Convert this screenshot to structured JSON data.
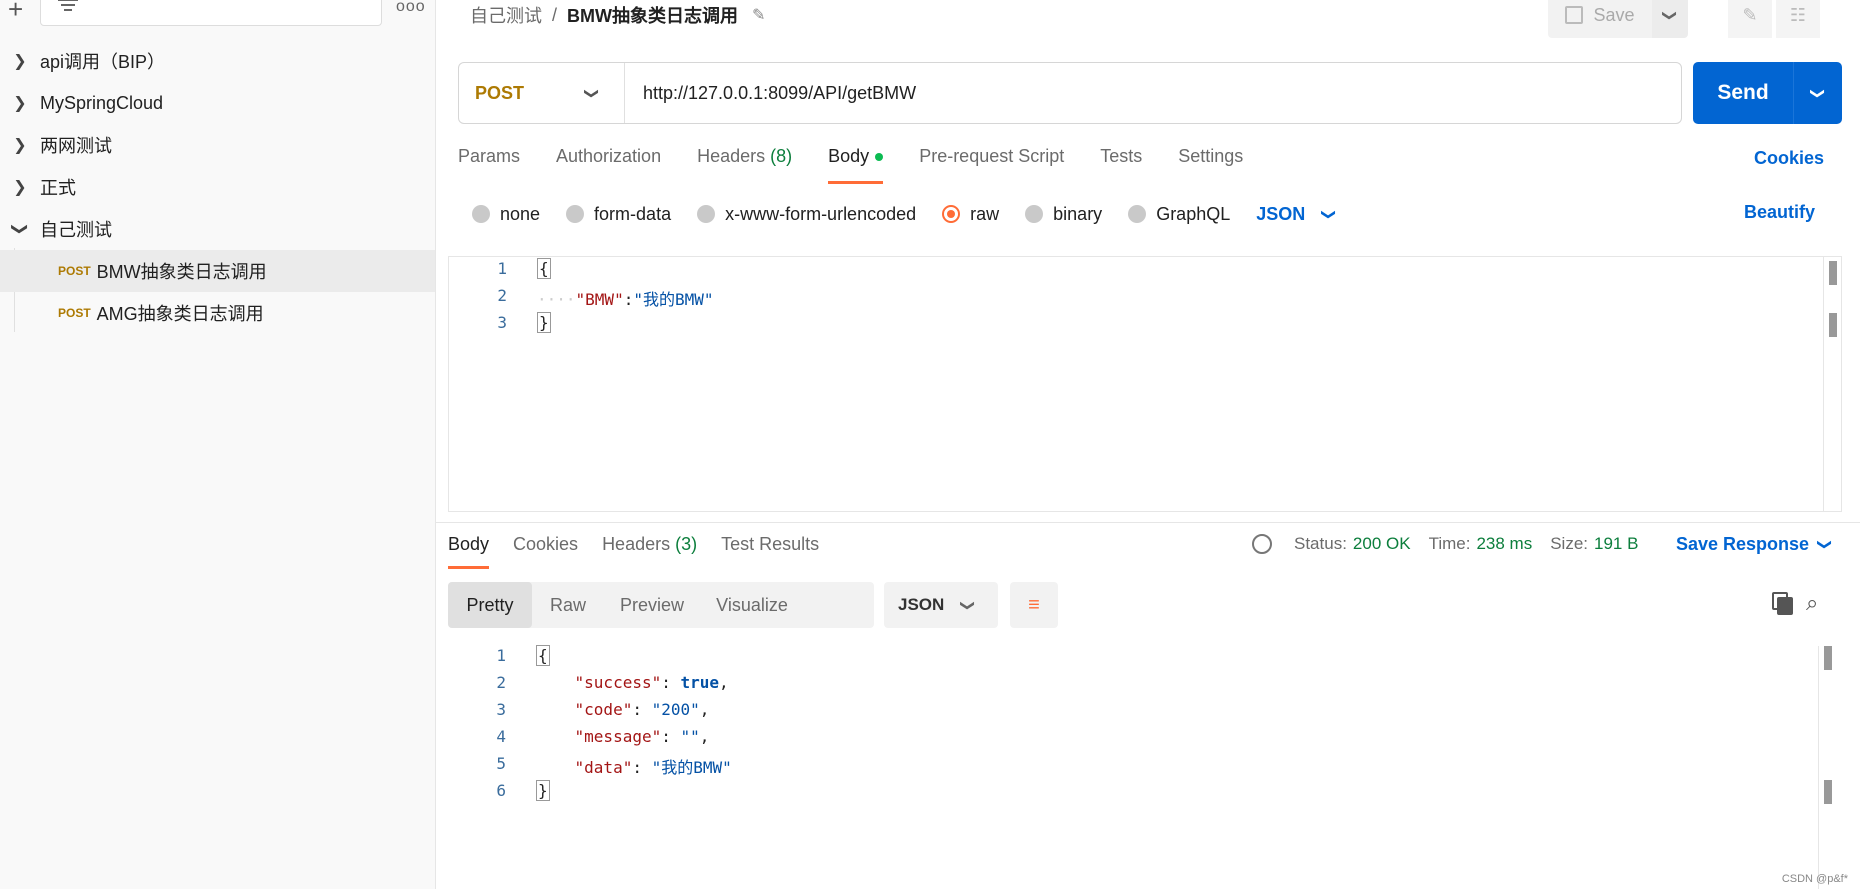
{
  "sidebar": {
    "collections": [
      {
        "label": "api调用（BIP）",
        "expanded": false
      },
      {
        "label": "MySpringCloud",
        "expanded": false
      },
      {
        "label": "两网测试",
        "expanded": false
      },
      {
        "label": "正式",
        "expanded": false
      },
      {
        "label": "自己测试",
        "expanded": true
      }
    ],
    "requests": [
      {
        "method": "POST",
        "name": "BMW抽象类日志调用",
        "selected": true
      },
      {
        "method": "POST",
        "name": "AMG抽象类日志调用",
        "selected": false
      }
    ]
  },
  "header": {
    "breadcrumb_parent": "自己测试",
    "breadcrumb_sep": "/",
    "title": "BMW抽象类日志调用",
    "save_label": "Save"
  },
  "request": {
    "method": "POST",
    "url": "http://127.0.0.1:8099/API/getBMW",
    "send_label": "Send"
  },
  "request_tabs": {
    "params": "Params",
    "authorization": "Authorization",
    "headers": "Headers",
    "headers_count": "(8)",
    "body": "Body",
    "prerequest": "Pre-request Script",
    "tests": "Tests",
    "settings": "Settings",
    "cookies": "Cookies"
  },
  "body_options": {
    "none": "none",
    "form_data": "form-data",
    "urlencoded": "x-www-form-urlencoded",
    "raw": "raw",
    "binary": "binary",
    "graphql": "GraphQL",
    "language": "JSON",
    "beautify": "Beautify"
  },
  "request_body": {
    "line_numbers": [
      "1",
      "2",
      "3"
    ],
    "open_brace": "{",
    "indent_dots": "····",
    "key": "\"BMW\"",
    "colon": ":",
    "value": "\"我的BMW\"",
    "close_brace": "}"
  },
  "response_tabs": {
    "body": "Body",
    "cookies": "Cookies",
    "headers": "Headers",
    "headers_count": "(3)",
    "test_results": "Test Results"
  },
  "response_status": {
    "status_label": "Status:",
    "status_value": "200 OK",
    "time_label": "Time:",
    "time_value": "238 ms",
    "size_label": "Size:",
    "size_value": "191 B",
    "save_response": "Save Response"
  },
  "response_views": {
    "pretty": "Pretty",
    "raw": "Raw",
    "preview": "Preview",
    "visualize": "Visualize",
    "format": "JSON"
  },
  "response_body": {
    "line_numbers": [
      "1",
      "2",
      "3",
      "4",
      "5",
      "6"
    ],
    "open_brace": "{",
    "k1": "\"success\"",
    "v1": "true",
    "k2": "\"code\"",
    "v2": "\"200\"",
    "k3": "\"message\"",
    "v3": "\"\"",
    "k4": "\"data\"",
    "v4": "\"我的BMW\"",
    "close_brace": "}"
  },
  "watermark": "CSDN @p&f*",
  "colors": {
    "accent": "#ff6c37",
    "primary": "#0265d2",
    "method_post": "#ad7a03",
    "status_ok": "#0c7e3c"
  }
}
